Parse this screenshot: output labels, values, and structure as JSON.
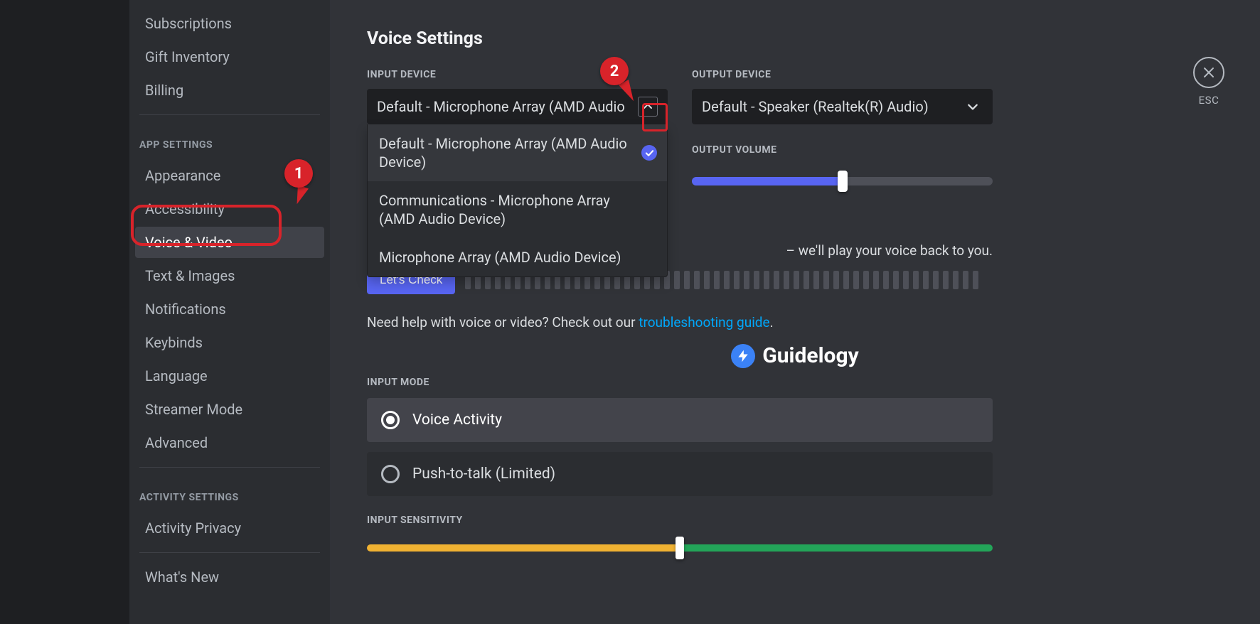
{
  "sidebar": {
    "items_top": [
      "Subscriptions",
      "Gift Inventory",
      "Billing"
    ],
    "header_app": "APP SETTINGS",
    "items_app": [
      "Appearance",
      "Accessibility",
      "Voice & Video",
      "Text & Images",
      "Notifications",
      "Keybinds",
      "Language",
      "Streamer Mode",
      "Advanced"
    ],
    "active_app_index": 2,
    "header_activity": "ACTIVITY SETTINGS",
    "items_activity": [
      "Activity Privacy",
      "What's New"
    ]
  },
  "page": {
    "title": "Voice Settings",
    "input_device_label": "INPUT DEVICE",
    "output_device_label": "OUTPUT DEVICE",
    "input_device_value": "Default - Microphone Array (AMD Audio",
    "output_device_value": "Default - Speaker (Realtek(R) Audio)",
    "input_options": [
      "Default - Microphone Array (AMD Audio Device)",
      "Communications - Microphone Array (AMD Audio Device)",
      "Microphone Array (AMD Audio Device)"
    ],
    "input_selected_index": 0,
    "output_volume_label": "OUTPUT VOLUME",
    "output_volume_percent": 50,
    "hint_tail": "– we'll play your voice back to you.",
    "lets_check": "Let's Check",
    "help_prefix": "Need help with voice or video? Check out our ",
    "help_link": "troubleshooting guide",
    "help_suffix": ".",
    "input_mode_label": "INPUT MODE",
    "mode_voice": "Voice Activity",
    "mode_ptt": "Push-to-talk (Limited)",
    "input_sensitivity_label": "INPUT SENSITIVITY",
    "watermark": "Guidelogy"
  },
  "close": {
    "label": "ESC"
  },
  "annotations": {
    "one": "1",
    "two": "2"
  }
}
